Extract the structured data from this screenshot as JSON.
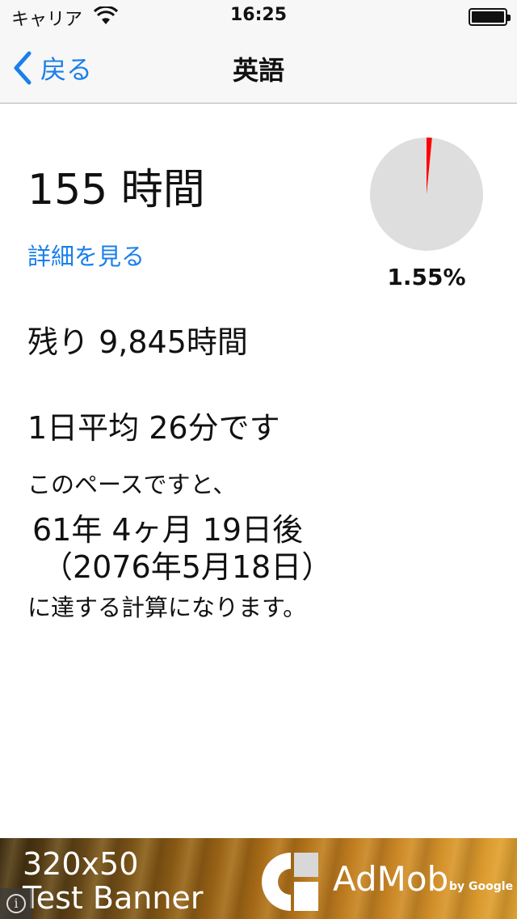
{
  "status_bar": {
    "carrier": "キャリア",
    "time": "16:25"
  },
  "nav": {
    "back_label": "戻る",
    "title": "英語"
  },
  "summary": {
    "total_hours": "155 時間",
    "detail_link": "詳細を見る",
    "progress_percent_text": "1.55%",
    "progress_fraction": 0.0155,
    "progress_color": "#ff0000",
    "pie_background": "#dedede"
  },
  "stats": {
    "remaining": "残り 9,845時間",
    "daily_average": "1日平均 26分です",
    "pace_intro": "このペースですと、",
    "eta_duration": "61年 4ヶ月 19日後",
    "eta_date": "（2076年5月18日）",
    "reach_text": "に達する計算になります。"
  },
  "ad_banner": {
    "size_text": "320x50",
    "test_text": "Test Banner",
    "brand": "AdMob",
    "by_google": "by Google"
  },
  "colors": {
    "accent": "#1a7fea",
    "bar_background": "#f7f7f7"
  }
}
